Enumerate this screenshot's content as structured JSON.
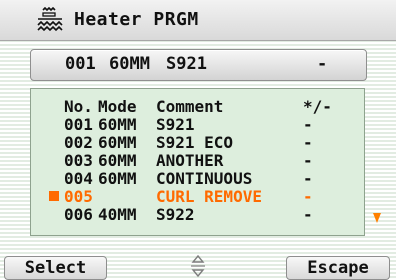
{
  "app": {
    "title": "Heater PRGM"
  },
  "icons": {
    "title": "heater-icon",
    "updown": "up-down-arrow-icon",
    "scroll": "scroll-down-arrow-icon"
  },
  "colors": {
    "selection": "#ff6a00"
  },
  "current": {
    "no": "001",
    "mode": "60MM",
    "comment": "S921",
    "flag": "-"
  },
  "list": {
    "header": {
      "no": "No.",
      "mode": "Mode",
      "comment": "Comment",
      "flag": "*/-"
    },
    "rows": [
      {
        "no": "001",
        "mode": "60MM",
        "comment": "S921",
        "flag": "-"
      },
      {
        "no": "002",
        "mode": "60MM",
        "comment": "S921 ECO",
        "flag": "-"
      },
      {
        "no": "003",
        "mode": "60MM",
        "comment": "ANOTHER",
        "flag": "-"
      },
      {
        "no": "004",
        "mode": "60MM",
        "comment": "CONTINUOUS",
        "flag": "-"
      },
      {
        "no": "005",
        "mode": "",
        "comment": "CURL REMOVE",
        "flag": "-",
        "selected": true
      },
      {
        "no": "006",
        "mode": "40MM",
        "comment": "S922",
        "flag": "-"
      }
    ]
  },
  "softkeys": {
    "left": "Select",
    "right": "Escape"
  }
}
